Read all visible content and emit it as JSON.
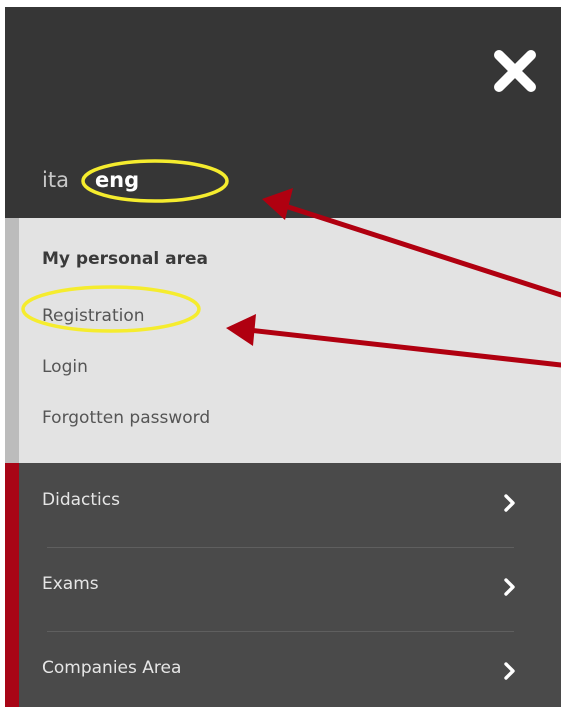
{
  "header": {
    "close_icon": "close-icon",
    "languages": {
      "ita": "ita",
      "eng": "eng"
    }
  },
  "personal_area": {
    "title": "My personal area",
    "links": {
      "registration": "Registration",
      "login": "Login",
      "forgot": "Forgotten password"
    }
  },
  "nav": {
    "items": [
      {
        "label": "Didactics",
        "icon": "chevron-right-icon"
      },
      {
        "label": "Exams",
        "icon": "chevron-right-icon"
      },
      {
        "label": "Companies Area",
        "icon": "chevron-right-icon"
      }
    ]
  },
  "colors": {
    "header_bg": "#363636",
    "personal_bg": "#e3e3e3",
    "nav_bg": "#4a4a4a",
    "nav_accent": "#a80516",
    "highlight_ring": "#f5ec2e",
    "annotation_arrow": "#b00010"
  }
}
